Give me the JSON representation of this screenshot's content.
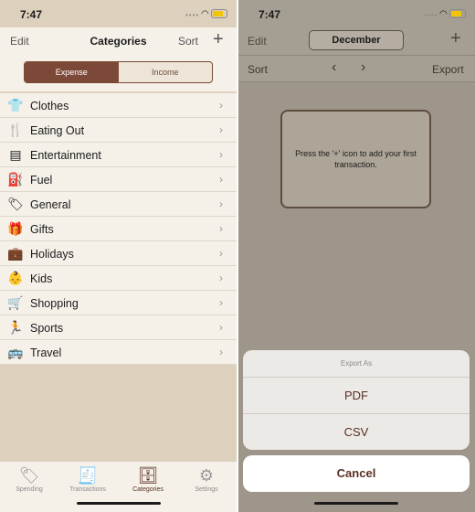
{
  "status": {
    "time": "7:47",
    "signal": "••••",
    "wifi": "◠",
    "battery_level": 0.75,
    "battery_color": "#f2c500"
  },
  "left": {
    "nav": {
      "edit": "Edit",
      "title": "Categories",
      "sort": "Sort",
      "add": "+"
    },
    "segments": [
      {
        "label": "Expense",
        "selected": true
      },
      {
        "label": "Income",
        "selected": false
      }
    ],
    "categories": [
      {
        "label": "Clothes",
        "icon": "shirt-icon",
        "glyph": "👕"
      },
      {
        "label": "Eating Out",
        "icon": "fork-knife-icon",
        "glyph": "🍴"
      },
      {
        "label": "Entertainment",
        "icon": "ipod-icon",
        "glyph": "▤"
      },
      {
        "label": "Fuel",
        "icon": "fuel-pump-icon",
        "glyph": "⛽"
      },
      {
        "label": "General",
        "icon": "tag-icon",
        "glyph": "🏷"
      },
      {
        "label": "Gifts",
        "icon": "gift-icon",
        "glyph": "🎁"
      },
      {
        "label": "Holidays",
        "icon": "suitcase-icon",
        "glyph": "💼"
      },
      {
        "label": "Kids",
        "icon": "baby-icon",
        "glyph": "👶"
      },
      {
        "label": "Shopping",
        "icon": "cart-icon",
        "glyph": "🛒"
      },
      {
        "label": "Sports",
        "icon": "runner-icon",
        "glyph": "🏃"
      },
      {
        "label": "Travel",
        "icon": "bus-icon",
        "glyph": "🚌"
      }
    ],
    "chevron": "›",
    "tabs": [
      {
        "label": "Spending",
        "icon": "tag-icon",
        "glyph": "🏷",
        "active": false
      },
      {
        "label": "Transactions",
        "icon": "receipt-icon",
        "glyph": "🧾",
        "active": false
      },
      {
        "label": "Categories",
        "icon": "drawers-icon",
        "glyph": "🗄",
        "active": true
      },
      {
        "label": "Settings",
        "icon": "gear-icon",
        "glyph": "⚙",
        "active": false
      }
    ]
  },
  "right": {
    "nav": {
      "edit": "Edit",
      "month": "December",
      "add": "+"
    },
    "toolbar": {
      "sort": "Sort",
      "prev": "‹",
      "next": "›",
      "export": "Export"
    },
    "empty_message": "Press the '+' icon to add your first transaction.",
    "sheet": {
      "title": "Export As",
      "options": [
        "PDF",
        "CSV"
      ],
      "cancel": "Cancel"
    }
  },
  "colors": {
    "accent": "#7c4837",
    "sheet_text": "#5a2f22",
    "list_bg": "#f5f1e9",
    "page_bg": "#ddd1bd",
    "dimmed_bg": "#a59e93"
  }
}
